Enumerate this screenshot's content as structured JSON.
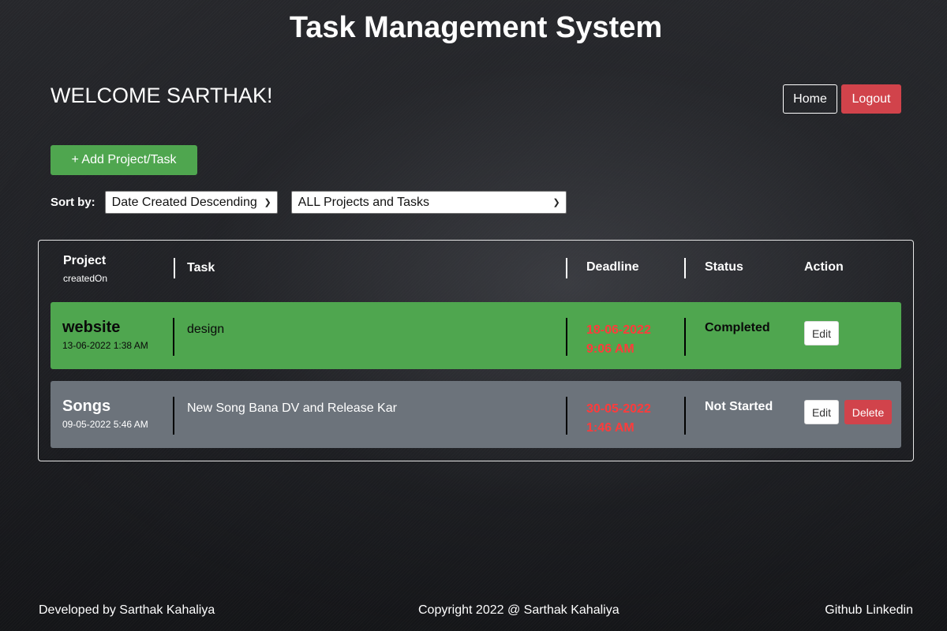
{
  "app": {
    "title": "Task Management System"
  },
  "header": {
    "welcome": "WELCOME SARTHAK!",
    "home_label": "Home",
    "logout_label": "Logout"
  },
  "toolbar": {
    "add_label": "+ Add Project/Task",
    "sort_label": "Sort by:",
    "sort_value": "Date Created Descending",
    "filter_value": "ALL Projects and Tasks"
  },
  "table": {
    "headers": {
      "project": "Project",
      "project_sub": "createdOn",
      "task": "Task",
      "deadline": "Deadline",
      "status": "Status",
      "action": "Action"
    },
    "rows": [
      {
        "project": "website",
        "created": "13-06-2022 1:38 AM",
        "task": "design",
        "deadline_date": "18-06-2022",
        "deadline_time": "9:06 AM",
        "status": "Completed",
        "edit_label": "Edit"
      },
      {
        "project": "Songs",
        "created": "09-05-2022 5:46 AM",
        "task": "New Song Bana DV and Release Kar",
        "deadline_date": "30-05-2022",
        "deadline_time": "1:46 AM",
        "status": "Not Started",
        "edit_label": "Edit",
        "delete_label": "Delete"
      }
    ]
  },
  "footer": {
    "developer": "Developed by Sarthak Kahaliya",
    "copyright": "Copyright 2022 @ Sarthak Kahaliya",
    "github": "Github",
    "linkedin": "Linkedin"
  },
  "colors": {
    "success": "#4fa64f",
    "danger": "#d1434b",
    "muted_row": "#6c737b",
    "deadline": "#ff3b3b"
  }
}
